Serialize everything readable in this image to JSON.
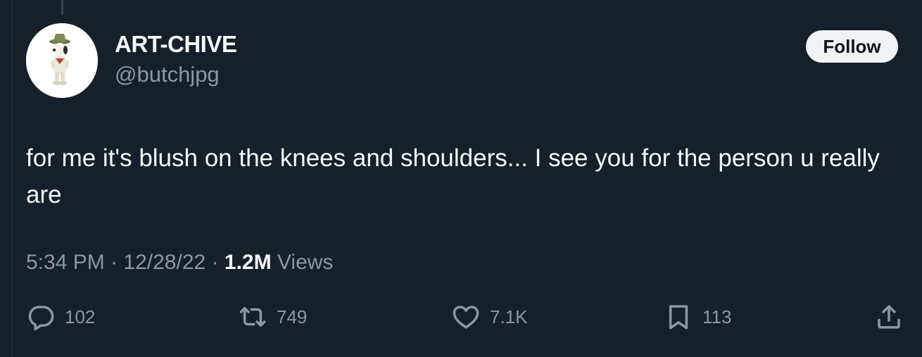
{
  "tweet": {
    "author": {
      "display_name": "ART-CHIVE",
      "handle": "@butchjpg",
      "avatar_icon": "snoopy-scout-figurine-avatar"
    },
    "follow_label": "Follow",
    "text": "for me it's blush on the knees and shoulders... I see you for the person u really are",
    "time": "5:34 PM",
    "separator": "·",
    "date": "12/28/22",
    "views_count": "1.2M",
    "views_label": "Views"
  },
  "actions": {
    "reply": {
      "icon": "reply-icon",
      "count": "102"
    },
    "retweet": {
      "icon": "retweet-icon",
      "count": "749"
    },
    "like": {
      "icon": "heart-icon",
      "count": "7.1K"
    },
    "bookmark": {
      "icon": "bookmark-icon",
      "count": "113"
    },
    "share": {
      "icon": "share-icon"
    }
  },
  "colors": {
    "background": "#15202b",
    "primary_text": "#f7f9f9",
    "secondary_text": "#8b98a5",
    "follow_button_bg": "#eff3f4",
    "follow_button_text": "#0f1419"
  }
}
